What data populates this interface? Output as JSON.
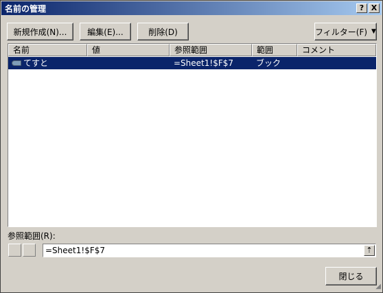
{
  "window": {
    "title": "名前の管理",
    "help_glyph": "?",
    "close_glyph": "X"
  },
  "toolbar": {
    "new_label": "新規作成(N)...",
    "edit_label": "編集(E)...",
    "delete_label": "削除(D)",
    "filter_label": "フィルター(F)",
    "filter_arrow": "▼"
  },
  "list": {
    "columns": [
      "名前",
      "値",
      "参照範囲",
      "範囲",
      "コメント"
    ],
    "rows": [
      {
        "name": "てすと",
        "value": "",
        "refers_to": "=Sheet1!$F$7",
        "scope": "ブック",
        "comment": ""
      }
    ]
  },
  "reference": {
    "label": "参照範囲(R):",
    "value": "=Sheet1!$F$7",
    "collapse_glyph": "⇡"
  },
  "footer": {
    "close_label": "閉じる"
  },
  "colors": {
    "title_gradient_start": "#0a246a",
    "title_gradient_end": "#a6caf0",
    "selection": "#0a246a",
    "face": "#d4d0c8"
  }
}
